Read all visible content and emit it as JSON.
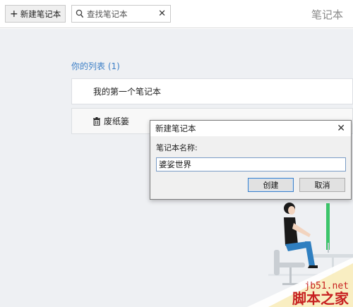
{
  "toolbar": {
    "new_notebook_label": "新建笔记本",
    "search_placeholder": "查找笔记本",
    "page_title": "笔记本"
  },
  "list": {
    "heading": "你的列表 (1)",
    "notebooks": [
      "我的第一个笔记本"
    ],
    "trash_label": "废纸篓"
  },
  "dialog": {
    "title": "新建笔记本",
    "field_label": "笔记本名称:",
    "field_value": "婆娑世界",
    "create_label": "创建",
    "cancel_label": "取消"
  },
  "watermark": {
    "url": "jb51.net",
    "name": "脚本之家"
  },
  "colors": {
    "accent": "#3c7fc6",
    "content_bg": "#eef0f3",
    "watermark": "#c72020"
  }
}
